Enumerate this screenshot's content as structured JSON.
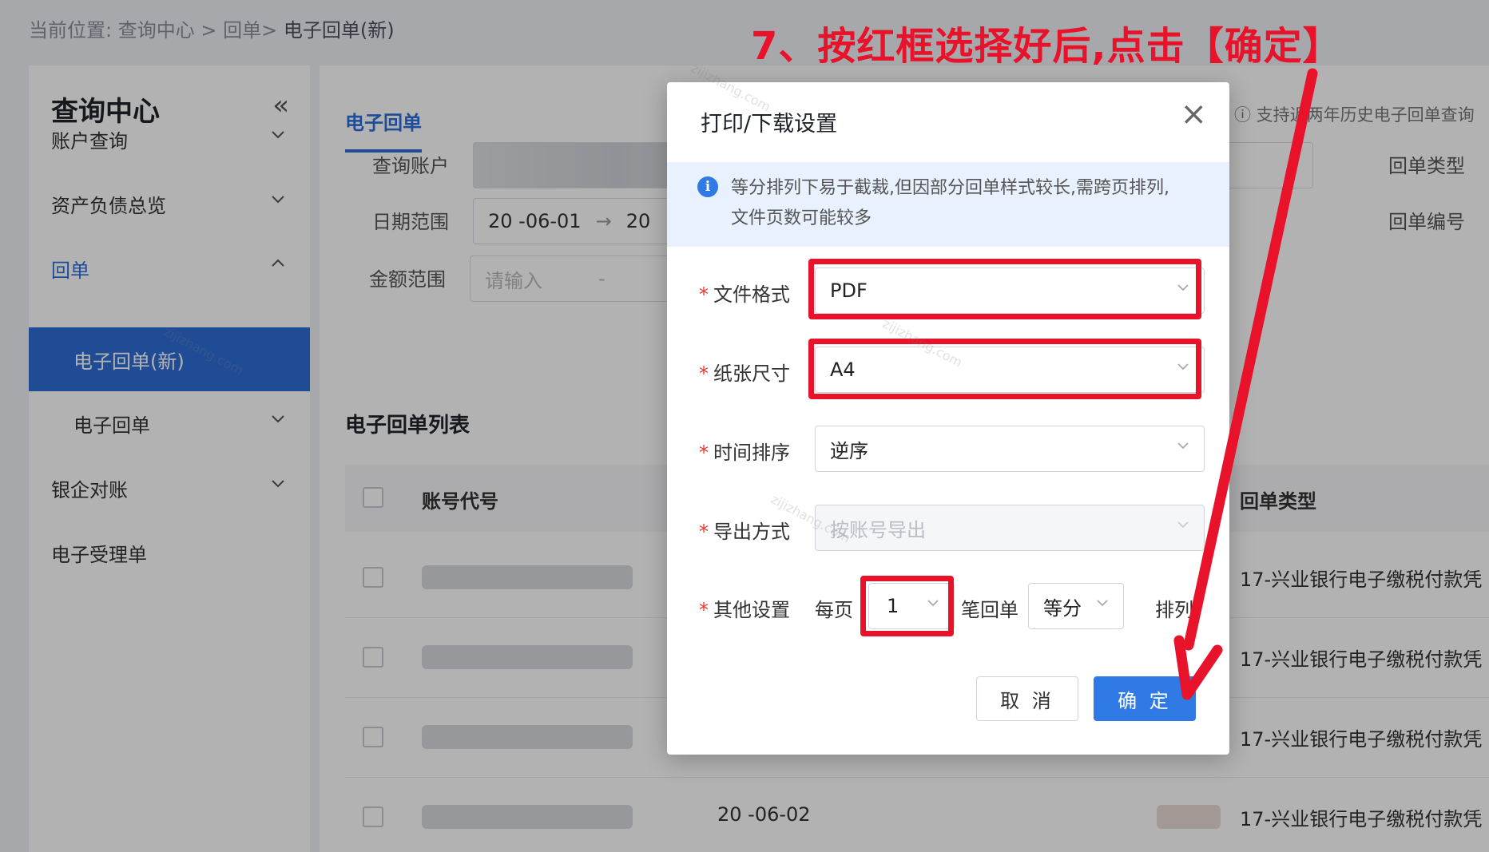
{
  "breadcrumb": {
    "prefix": "当前位置:",
    "items": [
      "查询中心",
      ">",
      "回单",
      ">"
    ],
    "current": "电子回单(新)"
  },
  "sidebar": {
    "title": "查询中心",
    "collapse_icon": "«",
    "items": [
      {
        "label": "账户查询"
      },
      {
        "label": "资产负债总览"
      },
      {
        "label": "回单"
      },
      {
        "label": "电子回单(新)"
      },
      {
        "label": "电子回单"
      },
      {
        "label": "银企对账"
      },
      {
        "label": "电子受理单"
      }
    ]
  },
  "main": {
    "tab": "电子回单",
    "hint": "ⓘ 支持近两年历史电子回单查询",
    "filters": {
      "account_label": "查询账户",
      "date_label": "日期范围",
      "date_start": "20   -06-01",
      "date_arrow": "→",
      "date_end": "20",
      "amount_label": "金额范围",
      "amount_placeholder": "请输入",
      "amount_dash": "-",
      "type_label": "回单类型",
      "no_label": "回单编号"
    },
    "list_title": "电子回单列表",
    "columns": {
      "account_code": "账号代号",
      "type": "回单类型"
    },
    "rows": [
      {
        "date": "",
        "type": "17-兴业银行电子缴税付款凭"
      },
      {
        "date": "",
        "type": "17-兴业银行电子缴税付款凭"
      },
      {
        "date": "",
        "type": "17-兴业银行电子缴税付款凭"
      },
      {
        "date": "20   -06-02",
        "type": "17-兴业银行电子缴税付款凭"
      }
    ]
  },
  "dialog": {
    "title": "打印/下载设置",
    "close_icon": "×",
    "info_icon": "i",
    "info": "等分排列下易于截裁,但因部分回单样式较长,需跨页排列,文件页数可能较多",
    "file_format": {
      "label": "文件格式",
      "value": "PDF"
    },
    "paper_size": {
      "label": "纸张尺寸",
      "value": "A4"
    },
    "time_order": {
      "label": "时间排序",
      "value": "逆序"
    },
    "export_mode": {
      "label": "导出方式",
      "value": "按账号导出"
    },
    "other": {
      "label": "其他设置",
      "per_page": "每页",
      "count": "1",
      "unit": "笔回单",
      "layout": "等分",
      "arrange": "排列"
    },
    "required_mark": "*",
    "cancel": "取 消",
    "ok": "确 定"
  },
  "annotation": {
    "headline": "7、按红框选择好后,点击【确定】",
    "color": "#e8132a"
  },
  "watermark": "zijizhang.com",
  "colors": {
    "primary": "#2f7ae5",
    "sidebar_active": "#2f6ed6",
    "highlight": "#e8132a"
  }
}
